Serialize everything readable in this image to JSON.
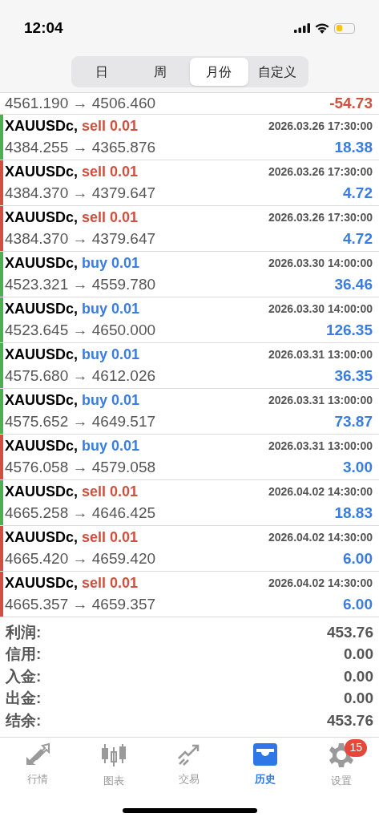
{
  "status_bar": {
    "time": "12:04"
  },
  "period_tabs": [
    {
      "label": "日",
      "selected": false
    },
    {
      "label": "周",
      "selected": false
    },
    {
      "label": "月份",
      "selected": true
    },
    {
      "label": "自定义",
      "selected": false
    }
  ],
  "partial_row": {
    "prices": "4561.190 → 4506.460",
    "profit": "-54.73",
    "loss": true
  },
  "trades": [
    {
      "symbol": "XAUUSDc,",
      "kind": "sell",
      "order": "sell 0.01",
      "time": "2026.03.26 17:30:00",
      "prices": "4384.255 → 4365.876",
      "profit": "18.38",
      "loss": false,
      "color": "#4caf50"
    },
    {
      "symbol": "XAUUSDc,",
      "kind": "sell",
      "order": "sell 0.01",
      "time": "2026.03.26 17:30:00",
      "prices": "4384.370 → 4379.647",
      "profit": "4.72",
      "loss": false,
      "color": "#d0503f"
    },
    {
      "symbol": "XAUUSDc,",
      "kind": "sell",
      "order": "sell 0.01",
      "time": "2026.03.26 17:30:00",
      "prices": "4384.370 → 4379.647",
      "profit": "4.72",
      "loss": false,
      "color": "#d0503f"
    },
    {
      "symbol": "XAUUSDc,",
      "kind": "buy",
      "order": "buy 0.01",
      "time": "2026.03.30 14:00:00",
      "prices": "4523.321 → 4559.780",
      "profit": "36.46",
      "loss": false,
      "color": "#4caf50"
    },
    {
      "symbol": "XAUUSDc,",
      "kind": "buy",
      "order": "buy 0.01",
      "time": "2026.03.30 14:00:00",
      "prices": "4523.645 → 4650.000",
      "profit": "126.35",
      "loss": false,
      "color": "#4caf50"
    },
    {
      "symbol": "XAUUSDc,",
      "kind": "buy",
      "order": "buy 0.01",
      "time": "2026.03.31 13:00:00",
      "prices": "4575.680 → 4612.026",
      "profit": "36.35",
      "loss": false,
      "color": "#4caf50"
    },
    {
      "symbol": "XAUUSDc,",
      "kind": "buy",
      "order": "buy 0.01",
      "time": "2026.03.31 13:00:00",
      "prices": "4575.652 → 4649.517",
      "profit": "73.87",
      "loss": false,
      "color": "#4caf50"
    },
    {
      "symbol": "XAUUSDc,",
      "kind": "buy",
      "order": "buy 0.01",
      "time": "2026.03.31 13:00:00",
      "prices": "4576.058 → 4579.058",
      "profit": "3.00",
      "loss": false,
      "color": "#d0503f"
    },
    {
      "symbol": "XAUUSDc,",
      "kind": "sell",
      "order": "sell 0.01",
      "time": "2026.04.02 14:30:00",
      "prices": "4665.258 → 4646.425",
      "profit": "18.83",
      "loss": false,
      "color": "#4caf50"
    },
    {
      "symbol": "XAUUSDc,",
      "kind": "sell",
      "order": "sell 0.01",
      "time": "2026.04.02 14:30:00",
      "prices": "4665.420 → 4659.420",
      "profit": "6.00",
      "loss": false,
      "color": "#d0503f"
    },
    {
      "symbol": "XAUUSDc,",
      "kind": "sell",
      "order": "sell 0.01",
      "time": "2026.04.02 14:30:00",
      "prices": "4665.357 → 4659.357",
      "profit": "6.00",
      "loss": false,
      "color": "#d0503f"
    }
  ],
  "summary": [
    {
      "label": "利润:",
      "value": "453.76"
    },
    {
      "label": "信用:",
      "value": "0.00"
    },
    {
      "label": "入金:",
      "value": "0.00"
    },
    {
      "label": "出金:",
      "value": "0.00"
    },
    {
      "label": "结余:",
      "value": "453.76"
    }
  ],
  "tab_bar": [
    {
      "kind": "quotes",
      "label": "行情",
      "selected": false
    },
    {
      "kind": "chart",
      "label": "图表",
      "selected": false
    },
    {
      "kind": "trade",
      "label": "交易",
      "selected": false
    },
    {
      "kind": "history",
      "label": "历史",
      "selected": true
    },
    {
      "kind": "settings",
      "label": "设置",
      "selected": false,
      "badge": "15"
    }
  ]
}
